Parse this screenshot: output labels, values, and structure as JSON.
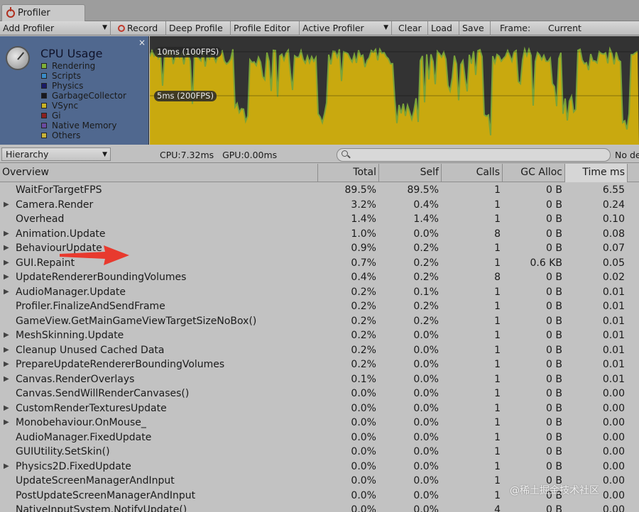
{
  "window": {
    "tab_title": "Profiler"
  },
  "toolbar": {
    "add_profiler": "Add Profiler",
    "record": "Record",
    "deep_profile": "Deep Profile",
    "profile_editor": "Profile Editor",
    "active_profiler": "Active Profiler",
    "clear": "Clear",
    "load": "Load",
    "save": "Save",
    "frame_label": "Frame:",
    "frame_value": "Current"
  },
  "cpu_panel": {
    "title": "CPU Usage",
    "close": "×",
    "legend": [
      {
        "label": "Rendering",
        "color": "#7fb13a"
      },
      {
        "label": "Scripts",
        "color": "#3a8cc8"
      },
      {
        "label": "Physics",
        "color": "#1a1a66"
      },
      {
        "label": "GarbageCollector",
        "color": "#17171f"
      },
      {
        "label": "VSync",
        "color": "#c9b426"
      },
      {
        "label": "Gi",
        "color": "#8a2020"
      },
      {
        "label": "Native Memory",
        "color": "#6a4aa0"
      },
      {
        "label": "Others",
        "color": "#c8b43a"
      }
    ]
  },
  "graph": {
    "label_10ms": "10ms (100FPS)",
    "label_5ms": "5ms (200FPS)",
    "fill_color": "#c9a90f",
    "edge_color": "#7aa33a"
  },
  "hierarchy_bar": {
    "view": "Hierarchy",
    "cpu": "CPU:7.32ms",
    "gpu": "GPU:0.00ms",
    "search_placeholder": "",
    "no_details": "No de"
  },
  "columns": {
    "overview": "Overview",
    "total": "Total",
    "self": "Self",
    "calls": "Calls",
    "gc_alloc": "GC Alloc",
    "time_ms": "Time ms"
  },
  "rows": [
    {
      "name": "WaitForTargetFPS",
      "expandable": false,
      "total": "89.5%",
      "self": "89.5%",
      "calls": "1",
      "gc": "0 B",
      "time": "6.55"
    },
    {
      "name": "Camera.Render",
      "expandable": true,
      "total": "3.2%",
      "self": "0.4%",
      "calls": "1",
      "gc": "0 B",
      "time": "0.24"
    },
    {
      "name": "Overhead",
      "expandable": false,
      "total": "1.4%",
      "self": "1.4%",
      "calls": "1",
      "gc": "0 B",
      "time": "0.10"
    },
    {
      "name": "Animation.Update",
      "expandable": true,
      "total": "1.0%",
      "self": "0.0%",
      "calls": "8",
      "gc": "0 B",
      "time": "0.08"
    },
    {
      "name": "BehaviourUpdate",
      "expandable": true,
      "total": "0.9%",
      "self": "0.2%",
      "calls": "1",
      "gc": "0 B",
      "time": "0.07"
    },
    {
      "name": "GUI.Repaint",
      "expandable": true,
      "total": "0.7%",
      "self": "0.2%",
      "calls": "1",
      "gc": "0.6 KB",
      "time": "0.05"
    },
    {
      "name": "UpdateRendererBoundingVolumes",
      "expandable": true,
      "total": "0.4%",
      "self": "0.2%",
      "calls": "8",
      "gc": "0 B",
      "time": "0.02"
    },
    {
      "name": "AudioManager.Update",
      "expandable": true,
      "total": "0.2%",
      "self": "0.1%",
      "calls": "1",
      "gc": "0 B",
      "time": "0.01"
    },
    {
      "name": "Profiler.FinalizeAndSendFrame",
      "expandable": false,
      "total": "0.2%",
      "self": "0.2%",
      "calls": "1",
      "gc": "0 B",
      "time": "0.01"
    },
    {
      "name": "GameView.GetMainGameViewTargetSizeNoBox()",
      "expandable": false,
      "total": "0.2%",
      "self": "0.2%",
      "calls": "1",
      "gc": "0 B",
      "time": "0.01"
    },
    {
      "name": "MeshSkinning.Update",
      "expandable": true,
      "total": "0.2%",
      "self": "0.0%",
      "calls": "1",
      "gc": "0 B",
      "time": "0.01"
    },
    {
      "name": "Cleanup Unused Cached Data",
      "expandable": true,
      "total": "0.2%",
      "self": "0.0%",
      "calls": "1",
      "gc": "0 B",
      "time": "0.01"
    },
    {
      "name": "PrepareUpdateRendererBoundingVolumes",
      "expandable": true,
      "total": "0.2%",
      "self": "0.0%",
      "calls": "1",
      "gc": "0 B",
      "time": "0.01"
    },
    {
      "name": "Canvas.RenderOverlays",
      "expandable": true,
      "total": "0.1%",
      "self": "0.0%",
      "calls": "1",
      "gc": "0 B",
      "time": "0.01"
    },
    {
      "name": "Canvas.SendWillRenderCanvases()",
      "expandable": false,
      "total": "0.0%",
      "self": "0.0%",
      "calls": "1",
      "gc": "0 B",
      "time": "0.00"
    },
    {
      "name": "CustomRenderTexturesUpdate",
      "expandable": true,
      "total": "0.0%",
      "self": "0.0%",
      "calls": "1",
      "gc": "0 B",
      "time": "0.00"
    },
    {
      "name": "Monobehaviour.OnMouse_",
      "expandable": true,
      "total": "0.0%",
      "self": "0.0%",
      "calls": "1",
      "gc": "0 B",
      "time": "0.00"
    },
    {
      "name": "AudioManager.FixedUpdate",
      "expandable": false,
      "total": "0.0%",
      "self": "0.0%",
      "calls": "1",
      "gc": "0 B",
      "time": "0.00"
    },
    {
      "name": "GUIUtility.SetSkin()",
      "expandable": false,
      "total": "0.0%",
      "self": "0.0%",
      "calls": "1",
      "gc": "0 B",
      "time": "0.00"
    },
    {
      "name": "Physics2D.FixedUpdate",
      "expandable": true,
      "total": "0.0%",
      "self": "0.0%",
      "calls": "1",
      "gc": "0 B",
      "time": "0.00"
    },
    {
      "name": "UpdateScreenManagerAndInput",
      "expandable": false,
      "total": "0.0%",
      "self": "0.0%",
      "calls": "1",
      "gc": "0 B",
      "time": "0.00"
    },
    {
      "name": "PostUpdateScreenManagerAndInput",
      "expandable": false,
      "total": "0.0%",
      "self": "0.0%",
      "calls": "1",
      "gc": "0 B",
      "time": "0.00"
    },
    {
      "name": "NativeInputSystem.NotifyUpdate()",
      "expandable": false,
      "total": "0.0%",
      "self": "0.0%",
      "calls": "4",
      "gc": "0 B",
      "time": "0.00"
    }
  ],
  "annotation": {
    "arrow_color": "#e83a2e"
  },
  "watermark": "@稀土掘金技术社区"
}
